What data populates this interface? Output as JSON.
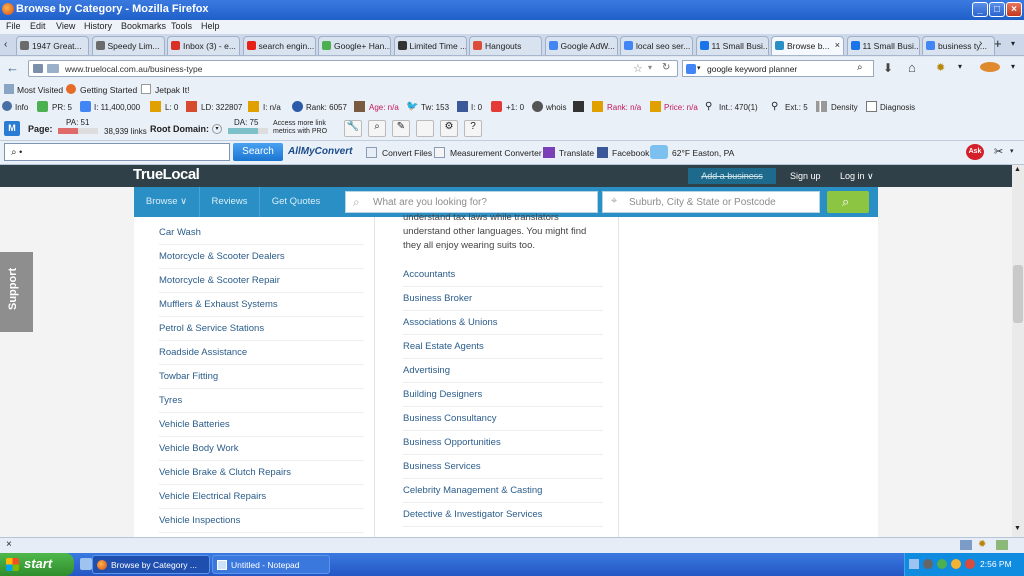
{
  "window": {
    "title": "Browse by Category - Mozilla Firefox"
  },
  "menu": [
    "File",
    "Edit",
    "View",
    "History",
    "Bookmarks",
    "Tools",
    "Help"
  ],
  "tabs": [
    {
      "label": "1947 Great...",
      "color": "#6b6b6b"
    },
    {
      "label": "Speedy Lim...",
      "color": "#6b6b6b"
    },
    {
      "label": "Inbox (3) - e...",
      "color": "#d93025"
    },
    {
      "label": "search engin...",
      "color": "#e62117"
    },
    {
      "label": "Google+ Han...",
      "color": "#4caf50"
    },
    {
      "label": "Limited Time ...",
      "color": "#333333"
    },
    {
      "label": "Hangouts",
      "color": "#dd4b39"
    },
    {
      "label": "Google AdW...",
      "color": "#4285f4"
    },
    {
      "label": "local seo ser...",
      "color": "#4285f4"
    },
    {
      "label": "11 Small Busi...",
      "color": "#1a73e8"
    },
    {
      "label": "Browse b...",
      "color": "#2a8fc4",
      "active": true
    },
    {
      "label": "11 Small Busi...",
      "color": "#1a73e8"
    },
    {
      "label": "business ty...",
      "color": "#4285f4"
    }
  ],
  "nav": {
    "url": "www.truelocal.com.au/business-type",
    "search_value": "google keyword planner"
  },
  "bookmarks": [
    "Most Visited",
    "Getting Started",
    "Jetpak It!"
  ],
  "seo": {
    "info": "Info",
    "pr": "PR: 5",
    "i": "I: 11,400,000",
    "l": "L: 0",
    "ld": "LD: 322807",
    "i2": "I: n/a",
    "rank": "Rank: 6057",
    "age": "Age: n/a",
    "tw": "Tw: 153",
    "fb": "I: 0",
    "gplus": "+1: 0",
    "whois": "whois",
    "rank2": "Rank: n/a",
    "price": "Price: n/a",
    "int": "Int.: 470(1)",
    "ext": "Ext.: 5",
    "density": "Density",
    "diagnosis": "Diagnosis"
  },
  "moz": {
    "page_label": "Page:",
    "pa": "PA: 51",
    "links": "38,939 links",
    "root_label": "Root Domain:",
    "da": "DA: 75",
    "access": "Access more link metrics with PRO",
    "pa_fill": 0.51,
    "da_fill": 0.75
  },
  "toolbar2": {
    "search_value": "•",
    "search_button": "Search",
    "allmyconvert": "AllMyConvert",
    "convert_files": "Convert Files",
    "measurement": "Measurement Converter",
    "translate": "Translate",
    "facebook": "Facebook",
    "weather": "62°F Easton, PA"
  },
  "site": {
    "logo": "TrueLocal",
    "add_business": "Add a business",
    "sign_up": "Sign up",
    "log_in": "Log in ∨",
    "nav": [
      "Browse ∨",
      "Reviews",
      "Get Quotes"
    ],
    "what_placeholder": "What are you looking for?",
    "where_placeholder": "Suburb, City & State or Postcode",
    "support": "Support",
    "left_list": [
      "Car Wash",
      "Motorcycle & Scooter Dealers",
      "Motorcycle & Scooter Repair",
      "Mufflers & Exhaust Systems",
      "Petrol & Service Stations",
      "Roadside Assistance",
      "Towbar Fitting",
      "Tyres",
      "Vehicle Batteries",
      "Vehicle Body Work",
      "Vehicle Brake & Clutch Repairs",
      "Vehicle Electrical Repairs",
      "Vehicle Inspections"
    ],
    "description": "understand tax laws while translators understand other languages. You might find they all enjoy wearing suits too.",
    "right_list": [
      "Accountants",
      "Business Broker",
      "Associations & Unions",
      "Real Estate Agents",
      "Advertising",
      "Building Designers",
      "Business Consultancy",
      "Business Opportunities",
      "Business Services",
      "Celebrity Management & Casting",
      "Detective & Investigator Services"
    ]
  },
  "taskbar": {
    "start": "start",
    "tasks": [
      "Browse by Category ...",
      "Untitled - Notepad"
    ],
    "clock": "2:56 PM"
  }
}
